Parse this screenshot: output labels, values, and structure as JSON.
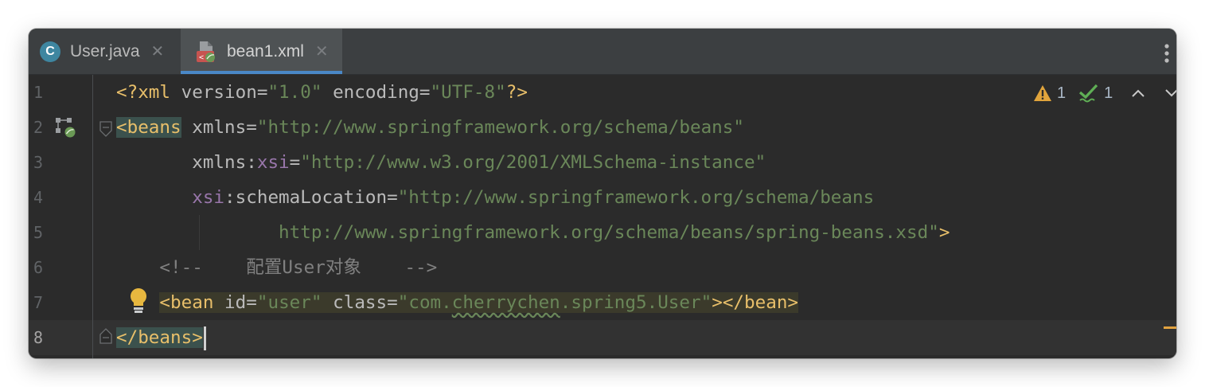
{
  "tabs": [
    {
      "label": "User.java",
      "icon": "java-class-icon",
      "icon_letter": "C",
      "active": false
    },
    {
      "label": "bean1.xml",
      "icon": "spring-xml-icon",
      "active": true
    }
  ],
  "line_numbers": [
    "1",
    "2",
    "3",
    "4",
    "5",
    "6",
    "7",
    "8"
  ],
  "code": {
    "line1": {
      "pi_open": "<?xml",
      "attr_version": "version",
      "eq": "=",
      "val_version": "\"1.0\"",
      "attr_encoding": "encoding",
      "val_encoding": "\"UTF-8\"",
      "pi_close": "?>"
    },
    "line2": {
      "tag_open": "<beans",
      "attr": "xmlns",
      "eq": "=",
      "value": "\"http://www.springframework.org/schema/beans\""
    },
    "line3": {
      "attr_prefix": "xmlns:",
      "ns": "xsi",
      "eq": "=",
      "value": "\"http://www.w3.org/2001/XMLSchema-instance\""
    },
    "line4": {
      "ns": "xsi",
      "attr_suffix": ":schemaLocation",
      "eq": "=",
      "value": "\"http://www.springframework.org/schema/beans"
    },
    "line5": {
      "value": "http://www.springframework.org/schema/beans/spring-beans.xsd\"",
      "tag_close": ">"
    },
    "line6": {
      "comment": "<!--    配置User对象    -->"
    },
    "line7": {
      "tag_open": "<bean",
      "attr_id": "id",
      "eq": "=",
      "val_id": "\"user\"",
      "attr_class": "class",
      "val_class_a": "\"com.",
      "val_class_b": "cherrychen",
      "val_class_c": ".spring5.User\"",
      "tag_close": "></bean>"
    },
    "line8": {
      "tag": "</beans>"
    }
  },
  "inspections": {
    "warnings": "1",
    "ok": "1"
  },
  "colors": {
    "background": "#2b2b2b",
    "tag": "#e8bf6a",
    "string": "#6a8759",
    "namespace": "#9876aa",
    "comment": "#808080",
    "accent": "#4a88c7"
  }
}
